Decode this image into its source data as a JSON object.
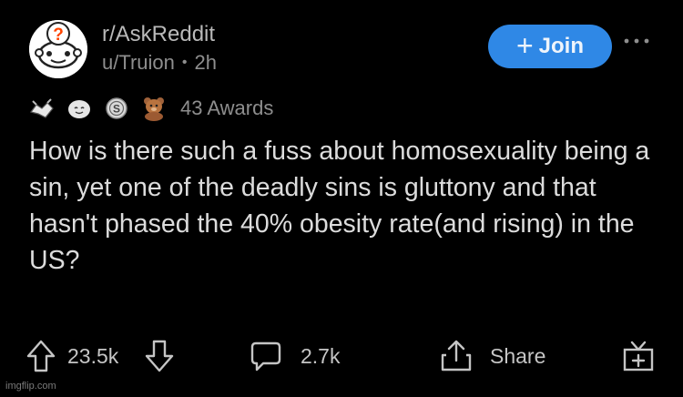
{
  "post": {
    "subreddit": "r/AskReddit",
    "author": "u/Truion",
    "separator": "•",
    "age": "2h",
    "join_label": "Join",
    "join_icon": "plus-icon",
    "more_icon": "more-icon",
    "awards_count": "43 Awards",
    "award_icons": [
      "handshake-award-icon",
      "wholesome-award-icon",
      "silver-award-icon",
      "bear-award-icon"
    ],
    "title": "How is there such a fuss about homosexuality being a sin, yet one of the deadly sins is gluttony and that hasn't phased the 40% obesity rate(and rising) in the US?"
  },
  "actions": {
    "upvotes": "23.5k",
    "comments": "2.7k",
    "share_label": "Share"
  },
  "watermark": "imgflip.com",
  "colors": {
    "background": "#000000",
    "accent": "#2f88e6",
    "text": "#dcdcdc",
    "muted": "#8e8e8e"
  }
}
